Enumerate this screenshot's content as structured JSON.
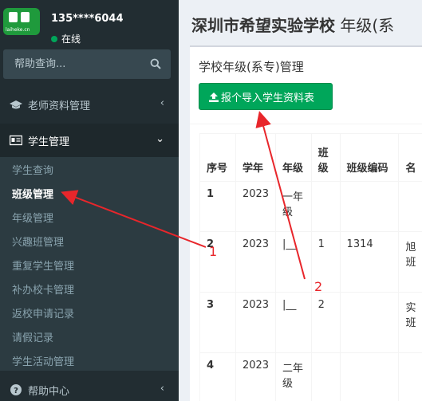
{
  "sidebar": {
    "logo_text": "laiheke.cn",
    "user_name": "135****6044",
    "status": "在线",
    "search_placeholder": "帮助查询...",
    "menu": {
      "teacher": "老师资料管理",
      "student": "学生管理",
      "help": "帮助中心"
    },
    "submenu": [
      "学生查询",
      "班级管理",
      "年级管理",
      "兴趣班管理",
      "重复学生管理",
      "补办校卡管理",
      "返校申请记录",
      "请假记录",
      "学生活动管理"
    ]
  },
  "main": {
    "title_school": "深圳市希望实验学校",
    "title_suffix": "年级(系",
    "box_title": "学校年级(系专)管理",
    "import_button": "报个导入学生资料表",
    "table": {
      "headers": [
        "序号",
        "学年",
        "年级",
        "班级",
        "班级编码",
        "名"
      ],
      "rows": [
        [
          "1",
          "2023",
          "一年级",
          "",
          "",
          ""
        ],
        [
          "2",
          "2023",
          "|__",
          "1",
          "1314",
          "旭班"
        ],
        [
          "3",
          "2023",
          "|__",
          "2",
          "",
          "实班"
        ],
        [
          "4",
          "2023",
          "二年级",
          "",
          "",
          ""
        ]
      ]
    }
  },
  "annotations": [
    "1",
    "2"
  ],
  "colors": {
    "sidebar_bg": "#222d32",
    "submenu_bg": "#2c3b41",
    "button_green": "#00a65a",
    "annotation_red": "#e8262b"
  }
}
